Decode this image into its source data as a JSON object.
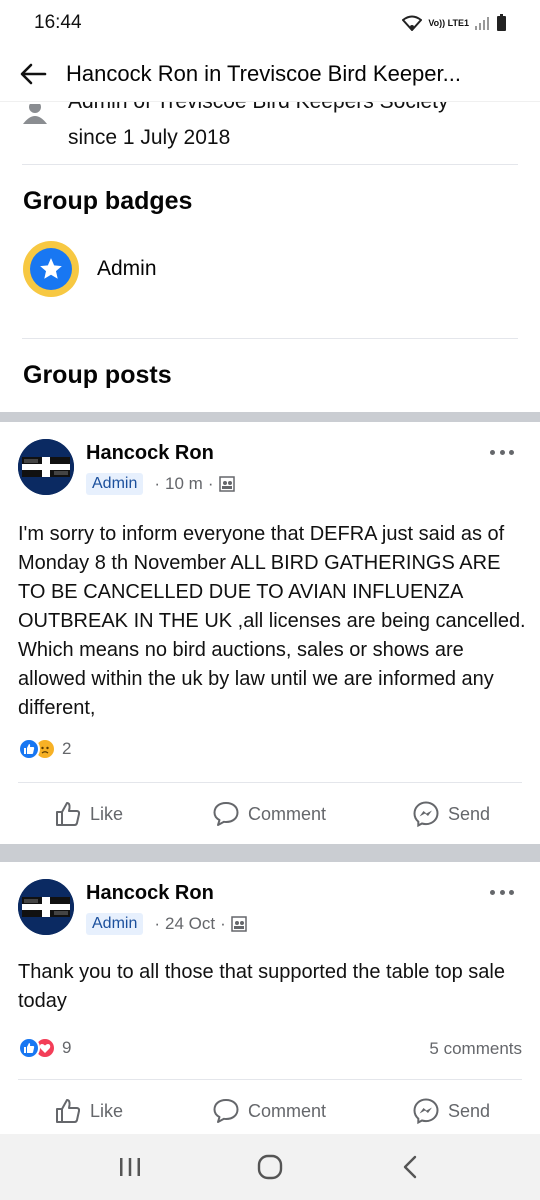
{
  "status_bar": {
    "time": "16:44",
    "network": "Vo)) LTE1"
  },
  "app_bar": {
    "title": "Hancock Ron in Treviscoe Bird Keeper..."
  },
  "admin_info": {
    "line1": "Admin of Treviscoe Bird Keepers Society",
    "line2": "since 1 July 2018"
  },
  "badges": {
    "title": "Group badges",
    "items": [
      {
        "label": "Admin",
        "icon": "star-badge-icon"
      }
    ]
  },
  "group_posts": {
    "title": "Group posts"
  },
  "posts": [
    {
      "author": "Hancock Ron",
      "tag": "Admin",
      "time": "10 m",
      "privacy_icon": "members-icon",
      "text": "I'm sorry to inform everyone that DEFRA just said as of Monday 8 th November ALL BIRD GATHERINGS ARE TO BE CANCELLED DUE TO AVIAN INFLUENZA OUTBREAK IN THE UK ,all licenses are being cancelled. Which means no bird auctions, sales or shows are allowed within the uk by law until we are informed any different,",
      "reactions": [
        "like",
        "sad"
      ],
      "reaction_count": "2",
      "comments": "",
      "actions": {
        "like": "Like",
        "comment": "Comment",
        "send": "Send"
      }
    },
    {
      "author": "Hancock Ron",
      "tag": "Admin",
      "time": "24 Oct",
      "privacy_icon": "members-icon",
      "text": "Thank you to all those that supported the table top sale today",
      "reactions": [
        "like",
        "love"
      ],
      "reaction_count": "9",
      "comments": "5 comments",
      "actions": {
        "like": "Like",
        "comment": "Comment",
        "send": "Send"
      }
    }
  ],
  "colors": {
    "accent": "#1877f2",
    "badge_ring": "#f7c842",
    "separator": "#cacdd2",
    "muted_text": "#65676b"
  }
}
